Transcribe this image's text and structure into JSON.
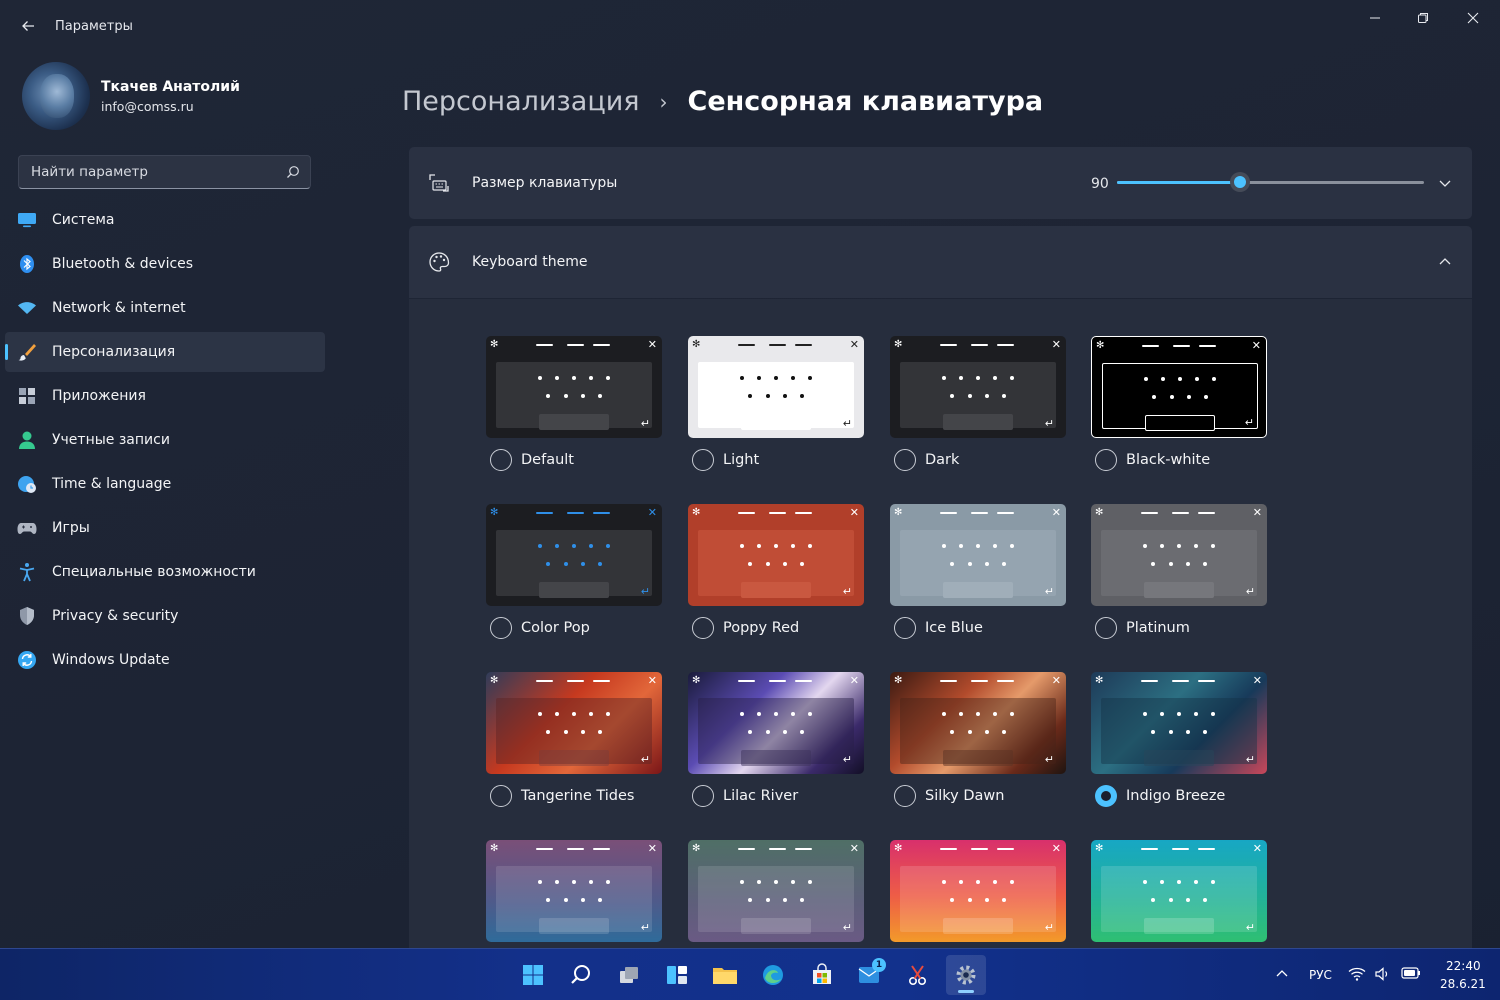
{
  "window": {
    "title": "Параметры",
    "back_icon": "arrow-left-icon",
    "controls": [
      "minimize-icon",
      "maximize-icon",
      "close-icon"
    ]
  },
  "profile": {
    "name": "Ткачев Анатолий",
    "email": "info@comss.ru"
  },
  "search": {
    "placeholder": "Найти параметр",
    "icon": "search-icon"
  },
  "sidebar": {
    "items": [
      {
        "label": "Система",
        "icon": "monitor-icon",
        "color": "#3fa9f5",
        "active": false
      },
      {
        "label": "Bluetooth & devices",
        "icon": "bluetooth-icon",
        "color": "#2f8ff0",
        "active": false
      },
      {
        "label": "Network & internet",
        "icon": "wifi-icon",
        "color": "#53b7f2",
        "active": false
      },
      {
        "label": "Персонализация",
        "icon": "brush-icon",
        "color": "#f2a03d",
        "active": true
      },
      {
        "label": "Приложения",
        "icon": "apps-icon",
        "color": "#9aa4b5",
        "active": false
      },
      {
        "label": "Учетные записи",
        "icon": "person-icon",
        "color": "#35c98f",
        "active": false
      },
      {
        "label": "Time & language",
        "icon": "globe-clock-icon",
        "color": "#3ea3ef",
        "active": false
      },
      {
        "label": "Игры",
        "icon": "gamepad-icon",
        "color": "#aeb5c2",
        "active": false
      },
      {
        "label": "Специальные возможности",
        "icon": "accessibility-icon",
        "color": "#4aa8f0",
        "active": false
      },
      {
        "label": "Privacy & security",
        "icon": "shield-icon",
        "color": "#8f98a8",
        "active": false
      },
      {
        "label": "Windows Update",
        "icon": "refresh-icon",
        "color": "#35a7f2",
        "active": false
      }
    ]
  },
  "breadcrumb": {
    "parent": "Персонализация",
    "separator": "›",
    "current": "Сенсорная клавиатура"
  },
  "keyboard_size": {
    "label": "Размер клавиатуры",
    "icon": "keyboard-resize-icon",
    "value_text": "90",
    "slider_fraction": 0.4,
    "expand_icon": "chevron-down-icon"
  },
  "keyboard_theme": {
    "label": "Keyboard theme",
    "icon": "palette-icon",
    "collapse_icon": "chevron-up-icon",
    "selected": "Indigo Breeze",
    "themes": [
      {
        "name": "Default",
        "bg": "#1c1d21",
        "panel": "#333438",
        "key": "#ffffff",
        "space": "#444549",
        "selected": false
      },
      {
        "name": "Light",
        "bg": "#e9e9ec",
        "panel": "#ffffff",
        "key": "#111111",
        "space": "#ffffff",
        "selected": false
      },
      {
        "name": "Dark",
        "bg": "#1c1d21",
        "panel": "#333438",
        "key": "#ffffff",
        "space": "#444549",
        "selected": false
      },
      {
        "name": "Black-white",
        "bg": "#000000",
        "panel": "#000000",
        "key": "#ffffff",
        "space": "#000000",
        "selected": false
      },
      {
        "name": "Color Pop",
        "bg": "#1c1d21",
        "panel": "#333438",
        "key": "#2f8fe8",
        "space": "#444549",
        "selected": false
      },
      {
        "name": "Poppy Red",
        "bg": "#b13f2a",
        "panel": "#c04d36",
        "key": "#ffffff",
        "space": "#c95840",
        "selected": false
      },
      {
        "name": "Ice Blue",
        "bg": "#8a9aa6",
        "panel": "#95a4b0",
        "key": "#ffffff",
        "space": "#a0aeb9",
        "selected": false
      },
      {
        "name": "Platinum",
        "bg": "#5f6065",
        "panel": "#6b6c71",
        "key": "#ffffff",
        "space": "#76777c",
        "selected": false
      },
      {
        "name": "Tangerine Tides",
        "bg": "linear-gradient(135deg,#2f3c5a 0%,#c6391f 40%,#e2673a 65%,#7a1618 100%)",
        "panel": "rgba(90,35,35,0.45)",
        "key": "#ffffff",
        "space": "rgba(120,60,60,0.45)",
        "selected": false
      },
      {
        "name": "Lilac River",
        "bg": "linear-gradient(135deg,#1a1b3b 0%,#5b4cb3 35%,#e3d7ef 55%,#3b2a6a 80%,#120f26 100%)",
        "panel": "rgba(40,30,70,0.45)",
        "key": "#ffffff",
        "space": "rgba(60,50,90,0.5)",
        "selected": false
      },
      {
        "name": "Silky Dawn",
        "bg": "linear-gradient(135deg,#3b1a12 0%,#b24b2c 35%,#e59a6a 55%,#6a2a1a 80%,#1f1410 100%)",
        "panel": "rgba(70,35,25,0.45)",
        "key": "#ffffff",
        "space": "rgba(90,50,35,0.5)",
        "selected": false
      },
      {
        "name": "Indigo Breeze",
        "bg": "linear-gradient(135deg,#1e3a58 0%,#2c6f82 40%,#173a5a 65%,#c9475a 100%)",
        "panel": "rgba(20,50,70,0.45)",
        "key": "#ffffff",
        "space": "rgba(40,70,90,0.5)",
        "selected": true
      },
      {
        "name": "",
        "bg": "linear-gradient(180deg,#7a4f78 0%,#4f5a8a 60%,#2f6b9a 100%)",
        "panel": "rgba(255,255,255,0.12)",
        "key": "#ffffff",
        "space": "rgba(255,255,255,0.15)",
        "selected": false
      },
      {
        "name": "",
        "bg": "linear-gradient(180deg,#4f6f66 0%,#5d5f7a 60%,#6a5a84 100%)",
        "panel": "rgba(255,255,255,0.12)",
        "key": "#ffffff",
        "space": "rgba(255,255,255,0.15)",
        "selected": false
      },
      {
        "name": "",
        "bg": "linear-gradient(180deg,#d8306c 0%,#ee5d46 55%,#f39a2a 100%)",
        "panel": "rgba(255,255,255,0.14)",
        "key": "#ffffff",
        "space": "rgba(255,255,255,0.18)",
        "selected": false
      },
      {
        "name": "",
        "bg": "linear-gradient(180deg,#17a7c4 0%,#22b29a 55%,#2fbf72 100%)",
        "panel": "rgba(255,255,255,0.14)",
        "key": "#ffffff",
        "space": "rgba(255,255,255,0.18)",
        "selected": false
      }
    ]
  },
  "taskbar": {
    "apps": [
      {
        "name": "start-icon",
        "active": false,
        "badge": ""
      },
      {
        "name": "search-icon",
        "active": false,
        "badge": ""
      },
      {
        "name": "task-view-icon",
        "active": false,
        "badge": ""
      },
      {
        "name": "widgets-icon",
        "active": false,
        "badge": ""
      },
      {
        "name": "file-explorer-icon",
        "active": false,
        "badge": ""
      },
      {
        "name": "edge-icon",
        "active": false,
        "badge": ""
      },
      {
        "name": "store-icon",
        "active": false,
        "badge": ""
      },
      {
        "name": "mail-icon",
        "active": false,
        "badge": "1"
      },
      {
        "name": "snipping-tool-icon",
        "active": false,
        "badge": ""
      },
      {
        "name": "settings-icon",
        "active": true,
        "badge": ""
      }
    ],
    "tray": {
      "lang": "РУС",
      "time": "22:40",
      "date": "28.6.21"
    }
  },
  "colors": {
    "accent": "#4cc2ff",
    "card": "#2a3142",
    "background": "#1f2636"
  }
}
